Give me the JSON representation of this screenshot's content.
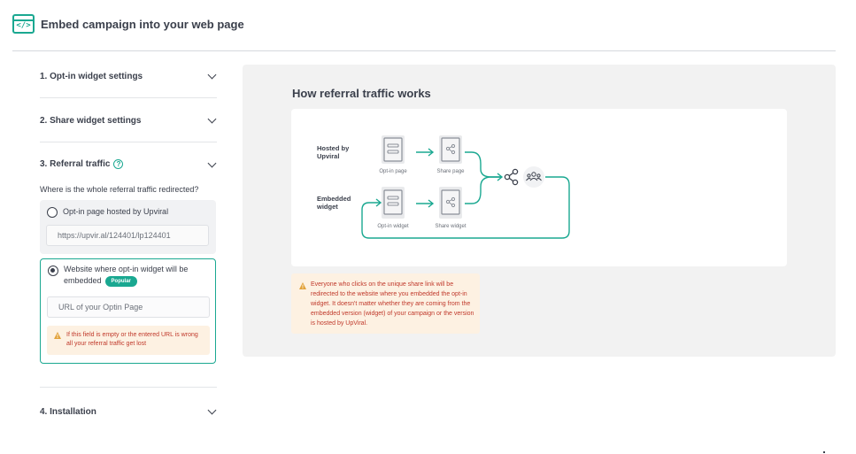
{
  "header": {
    "icon": "code-embed-icon",
    "icon_glyph": "</>",
    "title": "Embed campaign into your web page"
  },
  "accordion": {
    "items": [
      {
        "label": "1. Opt-in widget settings"
      },
      {
        "label": "2. Share widget settings"
      },
      {
        "label": "3. Referral traffic"
      },
      {
        "label": "4. Installation"
      }
    ],
    "help_glyph": "?"
  },
  "referral": {
    "question": "Where is the whole referral traffic redirected?",
    "option_hosted": {
      "label": "Opt-in page hosted by Upviral",
      "url_value": "https://upvir.al/124401/lp124401",
      "selected": false
    },
    "option_website": {
      "label_line1": "Website where opt-in widget will be",
      "label_line2": "embedded",
      "badge": "Popular",
      "input_placeholder": "URL of your Optin Page",
      "selected": true,
      "warning": "If this field is empty or the entered URL is wrong all your referral traffic get lost"
    }
  },
  "panel": {
    "title": "How referral traffic works",
    "diagram": {
      "row_labels": [
        [
          "Hosted by",
          "Upviral"
        ],
        [
          "Embedded",
          "widget"
        ]
      ],
      "nodes": [
        "Opt-in page",
        "Share page",
        "Opt-in widget",
        "Share widget"
      ]
    },
    "info": "Everyone who clicks on the unique share link will be redirected to the website where you embedded the opt-in widget. It doesn't matter whether they are coming from the embedded version (widget) of your campaign or the version is hosted by UpViral."
  },
  "colors": {
    "accent": "#1aa891",
    "warning_bg": "#fdf1e2",
    "warning_text": "#c0392b",
    "warning_icon": "#e2a23a",
    "panel_bg": "#f2f2f2"
  }
}
